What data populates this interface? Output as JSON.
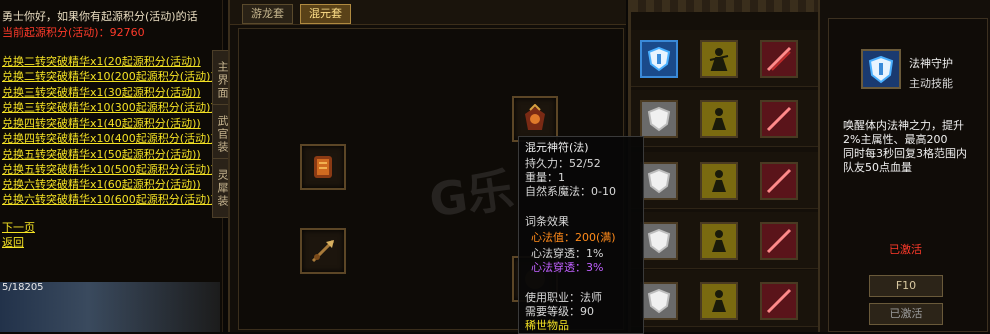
{
  "npc": {
    "greeting": "勇士你好，如果你有起源积分(活动)的话",
    "current_points_label": "当前起源积分(活动)：",
    "current_points_value": "92760",
    "options": [
      "兑换二转突破精华x1(20起源积分(活动))",
      "兑换二转突破精华x10(200起源积分(活动))",
      "兑换三转突破精华x1(30起源积分(活动))",
      "兑换三转突破精华x10(300起源积分(活动))",
      "兑换四转突破精华x1(40起源积分(活动))",
      "兑换四转突破精华x10(400起源积分(活动))",
      "兑换五转突破精华x1(50起源积分(活动))",
      "兑换五转突破精华x10(500起源积分(活动))",
      "兑换六转突破精华x1(60起源积分(活动))",
      "兑换六转突破精华x10(600起源积分(活动))"
    ],
    "next_page": "下一页",
    "back": "返回",
    "hp_text": "5/18205"
  },
  "side_tabs": [
    "主界面",
    "武官装",
    "灵犀装"
  ],
  "center": {
    "tabs": [
      "游龙套",
      "混元套"
    ],
    "active_tab": 1,
    "watermark": "G乐"
  },
  "tooltip": {
    "name": "混元神符(法)",
    "durability": "持久力：52/52",
    "weight": "重量：1",
    "magic": "自然系魔法：0-10",
    "affix_title": "词条效果",
    "affix1": "心法值：200(满)",
    "affix2": "心法穿透：1%",
    "affix3": "心法穿透：3%",
    "job": "使用职业：法师",
    "level": "需要等级：90",
    "rarity": "稀世物品"
  },
  "detail": {
    "skill_name": "法神守护",
    "skill_type": "主动技能",
    "desc": [
      "唤醒体内法神之力，提升",
      "2%主属性、最高200",
      "同时每3秒回复3格范围内",
      "队友50点血量"
    ],
    "status": "已激活",
    "hotkey_button": "F10",
    "activate_button": "已激活"
  },
  "colors": {
    "accent_gold": "#f4e224",
    "red_status": "#ff3a2a",
    "orange": "#ff8a1a",
    "purple": "#c060ff"
  }
}
